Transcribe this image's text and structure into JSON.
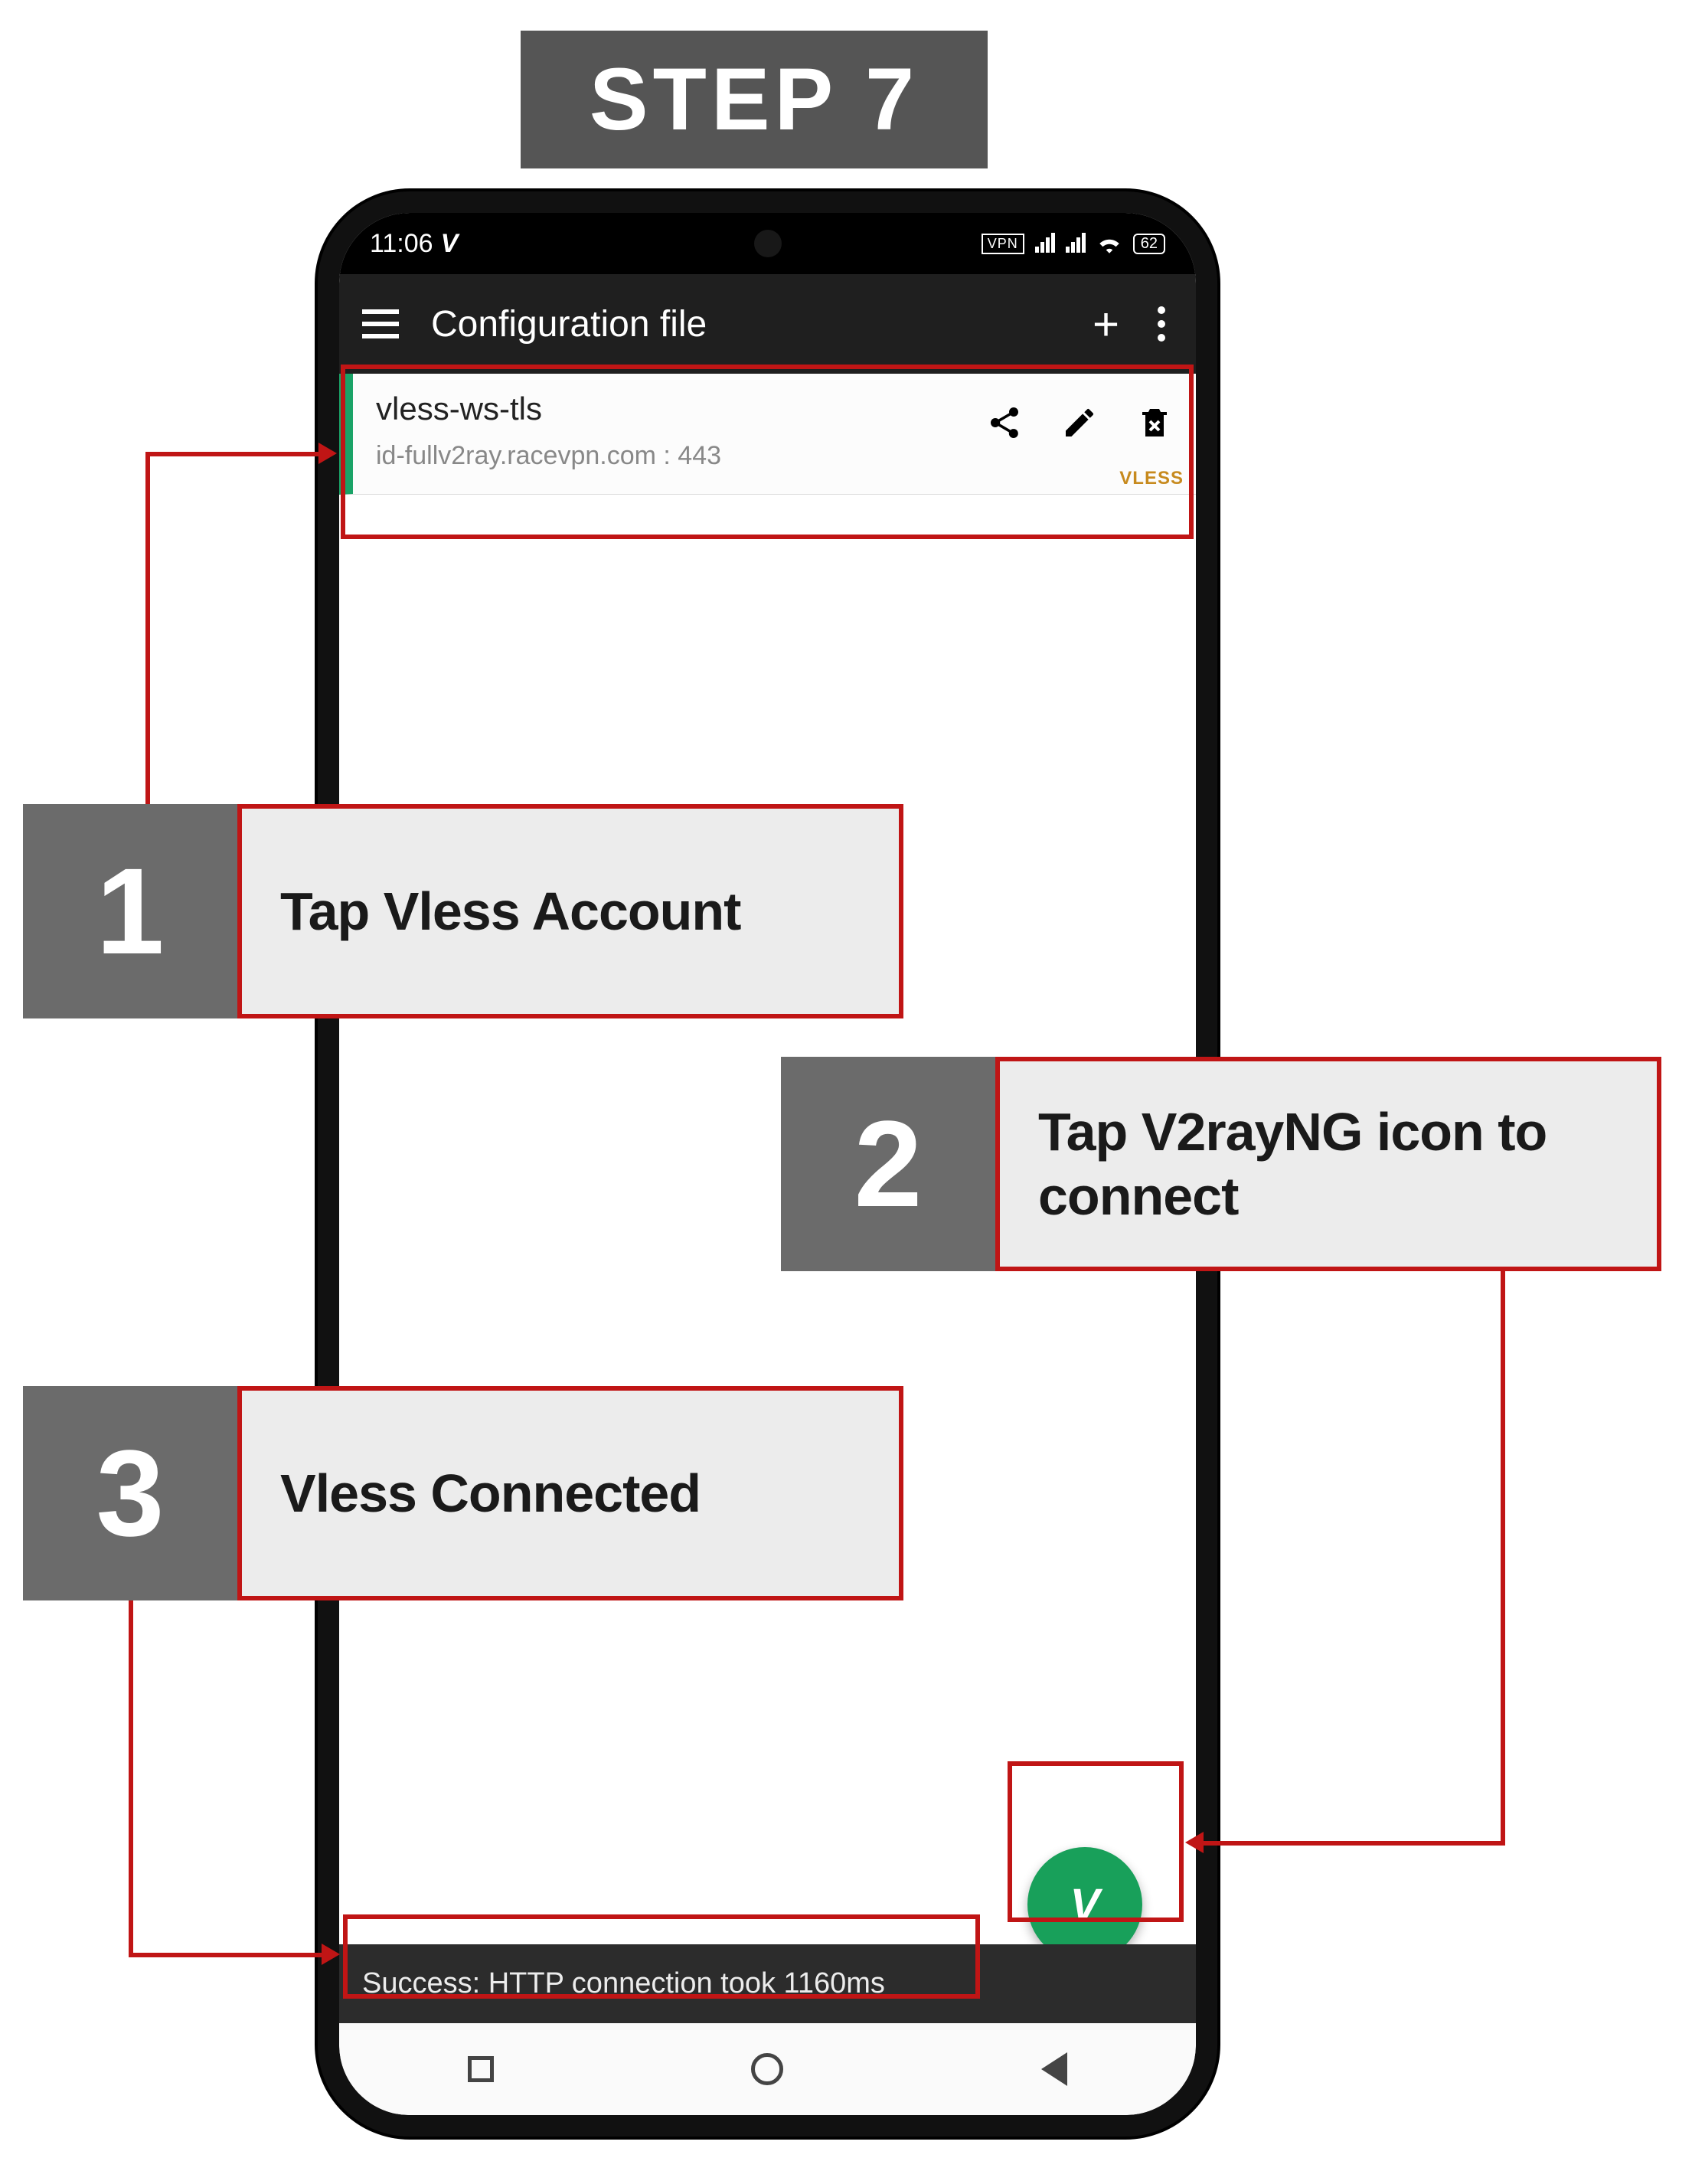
{
  "step_label": "STEP 7",
  "status": {
    "time": "11:06",
    "vpn_label": "VPN",
    "battery": "62"
  },
  "toolbar": {
    "title": "Configuration file"
  },
  "config": {
    "name": "vless-ws-tls",
    "server": "id-fullv2ray.racevpn.com : 443",
    "protocol_badge": "VLESS"
  },
  "fab": {
    "glyph": "V"
  },
  "toast": {
    "message": "Success: HTTP connection took 1160ms"
  },
  "callouts": {
    "c1": {
      "num": "1",
      "text": "Tap Vless Account"
    },
    "c2": {
      "num": "2",
      "text": "Tap V2rayNG icon to connect"
    },
    "c3": {
      "num": "3",
      "text": "Vless Connected"
    }
  }
}
